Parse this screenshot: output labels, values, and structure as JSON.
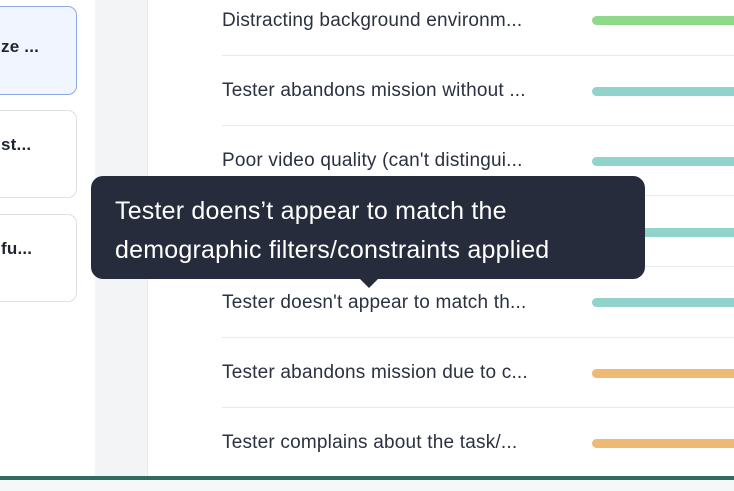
{
  "colors": {
    "green": "#8fd98a",
    "teal": "#8fd3cb",
    "orange": "#eeb972",
    "selected_border": "#8ea8e8"
  },
  "left_cards": [
    {
      "text": "ze ...",
      "selected": true
    },
    {
      "text": "st...",
      "selected": false
    },
    {
      "text": "fu...",
      "selected": false
    }
  ],
  "rows": [
    {
      "label": "Distracting background environm...",
      "color": "green"
    },
    {
      "label": "Tester abandons mission without ...",
      "color": "teal"
    },
    {
      "label": "Poor video quality (can't distingui...",
      "color": "teal"
    },
    {
      "label": "",
      "color": "teal"
    },
    {
      "label": "Tester doesn't appear to match th...",
      "color": "teal"
    },
    {
      "label": "Tester abandons mission due to c...",
      "color": "orange"
    },
    {
      "label": "Tester complains about the task/...",
      "color": "orange"
    }
  ],
  "tooltip": {
    "line1": "Tester doens’t appear to match the",
    "line2": "demographic filters/constraints applied"
  }
}
